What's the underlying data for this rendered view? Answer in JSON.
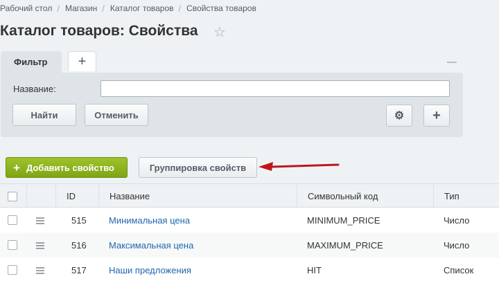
{
  "breadcrumb": [
    "Рабочий стол",
    "Магазин",
    "Каталог товаров",
    "Свойства товаров"
  ],
  "page": {
    "title": "Каталог товаров: Свойства",
    "star": "☆"
  },
  "filter": {
    "tab_label": "Фильтр",
    "add_tab_symbol": "+",
    "field_label": "Название:",
    "field_value": "",
    "find_label": "Найти",
    "cancel_label": "Отменить",
    "gear_symbol": "⚙",
    "plus_symbol": "+"
  },
  "toolbar": {
    "add_property_label": "Добавить свойство",
    "add_property_plus": "+",
    "group_properties_label": "Группировка свойств",
    "accent_green": "#8bb31f",
    "arrow_color": "#c0151b"
  },
  "grid": {
    "columns": [
      "ID",
      "Название",
      "Символьный код",
      "Тип"
    ],
    "rows": [
      {
        "id": "515",
        "name": "Минимальная цена",
        "code": "MINIMUM_PRICE",
        "type": "Число"
      },
      {
        "id": "516",
        "name": "Максимальная цена",
        "code": "MAXIMUM_PRICE",
        "type": "Число"
      },
      {
        "id": "517",
        "name": "Наши предложения",
        "code": "HIT",
        "type": "Список"
      }
    ]
  }
}
